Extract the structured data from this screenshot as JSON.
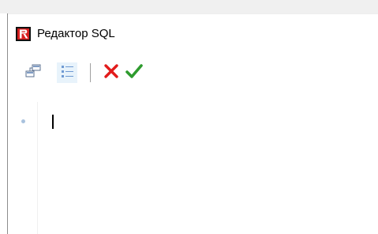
{
  "window": {
    "title": "Редактор SQL",
    "icon": "firebird-logo-icon"
  },
  "toolbar": {
    "buttons": [
      {
        "name": "structure",
        "icon": "tree-structure-icon",
        "hot": false
      },
      {
        "name": "list",
        "icon": "bulleted-list-icon",
        "hot": true
      },
      {
        "name": "cancel",
        "icon": "red-x-icon",
        "color": "#e21b1b"
      },
      {
        "name": "apply",
        "icon": "green-checkmark-icon",
        "color": "#2e9b2e"
      }
    ]
  },
  "editor": {
    "content": "",
    "line_marker_color": "#a9c2de"
  },
  "colors": {
    "accent_hot": "#e8f3fb",
    "cancel_red": "#e21b1b",
    "apply_green": "#2e9b2e"
  }
}
